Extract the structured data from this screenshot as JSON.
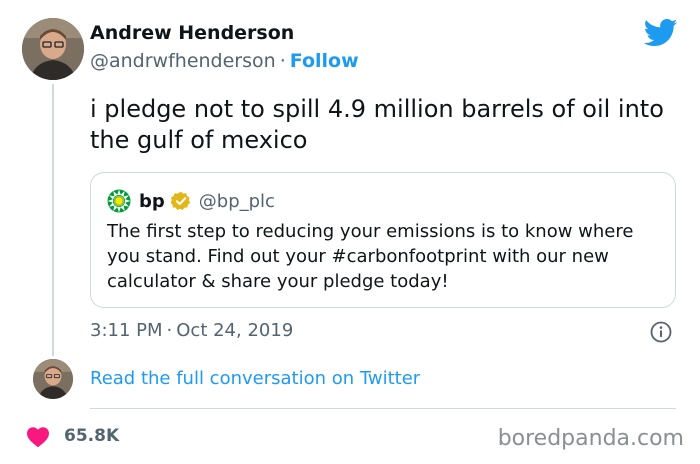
{
  "author": {
    "name": "Andrew Henderson",
    "handle": "@andrwfhenderson",
    "separator": "·",
    "follow_label": "Follow"
  },
  "tweet": {
    "text": "i pledge not to spill 4.9 million barrels of oil into the gulf of mexico",
    "time": "3:11 PM",
    "separator": "·",
    "date": "Oct 24, 2019"
  },
  "quoted": {
    "name": "bp",
    "handle": "@bp_plc",
    "text": "The first step to reducing your emissions is to know where you stand. Find out your #carbonfootprint with our new calculator & share your pledge today!"
  },
  "conversation_link": "Read the full conversation on Twitter",
  "likes": "65.8K",
  "watermark": "boredpanda.com",
  "icons": [
    "twitter-bird-icon",
    "verified-badge-icon",
    "info-icon",
    "heart-icon",
    "bp-logo"
  ],
  "colors": {
    "link_blue": "#1d9bf0",
    "text": "#0f1419",
    "muted": "#536471",
    "heart": "#f91880",
    "verified_gold": "#e2b719",
    "bp_green": "#009b3a",
    "bp_yellow": "#ffe600"
  }
}
